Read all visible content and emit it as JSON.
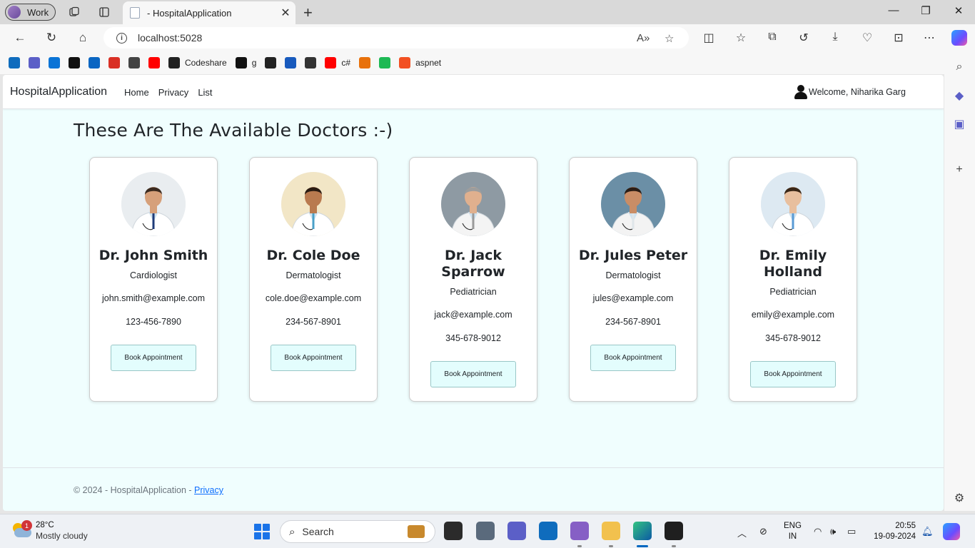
{
  "browser": {
    "profile_label": "Work",
    "tab_title": "- HospitalApplication",
    "url": "localhost:5028",
    "favorites": [
      {
        "label": "",
        "icon": "outlook-icon",
        "color": "#0f6cbd"
      },
      {
        "label": "",
        "icon": "teams-icon",
        "color": "#5b5fc7"
      },
      {
        "label": "",
        "icon": "onedrive-icon",
        "color": "#0a74d6"
      },
      {
        "label": "",
        "icon": "github-icon",
        "color": "#111111"
      },
      {
        "label": "",
        "icon": "linkedin-icon",
        "color": "#0a66c2"
      },
      {
        "label": "",
        "icon": "gmail-icon",
        "color": "#d93025"
      },
      {
        "label": "",
        "icon": "chatgpt-icon",
        "color": "#444444"
      },
      {
        "label": "",
        "icon": "youtube-icon",
        "color": "#ff0000"
      },
      {
        "label": "Codeshare",
        "icon": "codeshare-icon",
        "color": "#222222"
      },
      {
        "label": "g",
        "icon": "github-icon",
        "color": "#111111"
      },
      {
        "label": "",
        "icon": "c-icon",
        "color": "#222222"
      },
      {
        "label": "",
        "icon": "word-icon",
        "color": "#185abd"
      },
      {
        "label": "",
        "icon": "document-icon",
        "color": "#333333"
      },
      {
        "label": "c#",
        "icon": "youtube-icon",
        "color": "#ff0000"
      },
      {
        "label": "",
        "icon": "profile-icon",
        "color": "#e8710a"
      },
      {
        "label": "",
        "icon": "spotify-icon",
        "color": "#1db954"
      },
      {
        "label": "aspnet",
        "icon": "microsoft-icon",
        "color": "#f25022"
      }
    ]
  },
  "site": {
    "brand": "HospitalApplication",
    "nav": [
      "Home",
      "Privacy",
      "List"
    ],
    "welcome": "Welcome, Niharika Garg",
    "heading": "These Are The Available Doctors :-)",
    "button_label": "Book Appointment",
    "doctors": [
      {
        "name": "Dr. John Smith",
        "specialty": "Cardiologist",
        "email": "john.smith@example.com",
        "phone": "123-456-7890"
      },
      {
        "name": "Dr. Cole Doe",
        "specialty": "Dermatologist",
        "email": "cole.doe@example.com",
        "phone": "234-567-8901"
      },
      {
        "name": "Dr. Jack Sparrow",
        "specialty": "Pediatrician",
        "email": "jack@example.com",
        "phone": "345-678-9012"
      },
      {
        "name": "Dr. Jules Peter",
        "specialty": "Dermatologist",
        "email": "jules@example.com",
        "phone": "234-567-8901"
      },
      {
        "name": "Dr. Emily Holland",
        "specialty": "Pediatrician",
        "email": "emily@example.com",
        "phone": "345-678-9012"
      }
    ],
    "footer_text": "© 2024 - HospitalApplication - ",
    "footer_link": "Privacy"
  },
  "taskbar": {
    "weather_temp": "28°C",
    "weather_desc": "Mostly cloudy",
    "weather_badge": "1",
    "search_label": "Search",
    "lang_line1": "ENG",
    "lang_line2": "IN",
    "time": "20:55",
    "date": "19-09-2024"
  }
}
